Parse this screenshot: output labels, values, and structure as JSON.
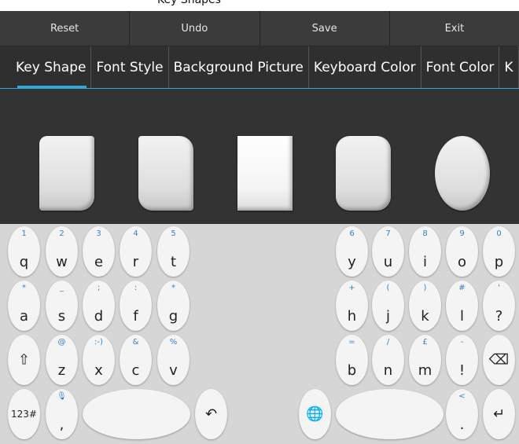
{
  "title_fragment": "Key Shapes",
  "menu": [
    "Reset",
    "Undo",
    "Save",
    "Exit"
  ],
  "tabs": [
    "Key Shape",
    "Font Style",
    "Background Picture",
    "Keyboard Color",
    "Font Color",
    "K"
  ],
  "active_tab": "Key Shape",
  "shapes": [
    "rounded-slant-1",
    "rounded-slant-2",
    "square",
    "rounded-rect",
    "oval"
  ],
  "keyboard": {
    "row1_left": [
      [
        "1",
        "q"
      ],
      [
        "2",
        "w"
      ],
      [
        "3",
        "e"
      ],
      [
        "4",
        "r"
      ],
      [
        "5",
        "t"
      ]
    ],
    "row1_right": [
      [
        "6",
        "y"
      ],
      [
        "7",
        "u"
      ],
      [
        "8",
        "i"
      ],
      [
        "9",
        "o"
      ],
      [
        "0",
        "p"
      ]
    ],
    "row2_left": [
      [
        "*",
        "a"
      ],
      [
        "_",
        "s"
      ],
      [
        ";",
        "d"
      ],
      [
        ":",
        "f"
      ],
      [
        "*",
        "g"
      ]
    ],
    "row2_right": [
      [
        "+",
        "h"
      ],
      [
        "(",
        "j"
      ],
      [
        ")",
        "k"
      ],
      [
        "#",
        "l"
      ],
      [
        "'",
        "?"
      ]
    ],
    "row3_left": [
      [
        "",
        "⇧"
      ],
      [
        "@",
        "z"
      ],
      [
        ":-)",
        "x"
      ],
      [
        "&",
        "c"
      ],
      [
        "%",
        "v"
      ]
    ],
    "row3_right": [
      [
        "=",
        "b"
      ],
      [
        "/",
        "n"
      ],
      [
        "£",
        "m"
      ],
      [
        "-",
        "!"
      ],
      [
        "",
        "⌫"
      ]
    ],
    "bottom": {
      "num_key": "123#",
      "mic_hint": "🎙",
      "comma": ",",
      "undo_icon": "↶",
      "globe_icon": "🌐",
      "lt_hint": "<",
      "period": ".",
      "enter_icon": "↵"
    }
  }
}
